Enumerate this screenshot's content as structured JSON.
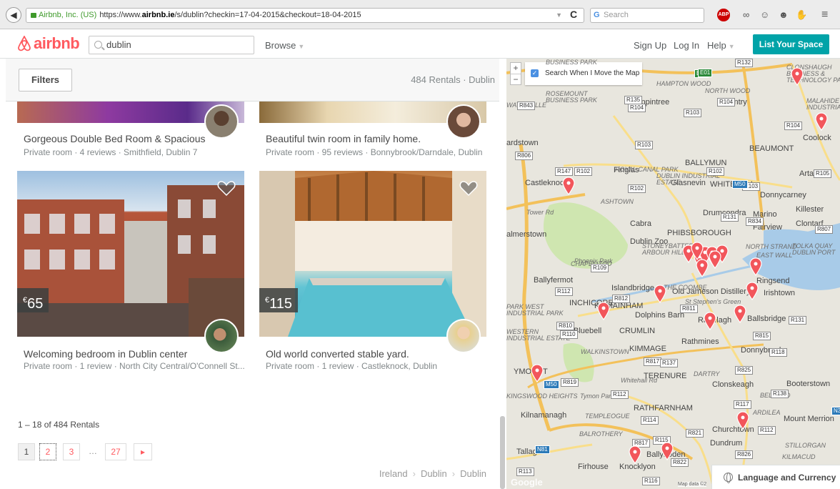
{
  "browser": {
    "site_identity": "Airbnb, Inc. (US)",
    "url_prefix": "https://www.",
    "url_domain": "airbnb.ie",
    "url_rest": "/s/dublin?checkin=17-04-2015&checkout=18-04-2015",
    "search_placeholder": "Search",
    "abp_label": "ABP"
  },
  "header": {
    "logo_text": "airbnb",
    "search_value": "dublin",
    "browse_label": "Browse",
    "signup_label": "Sign Up",
    "login_label": "Log In",
    "help_label": "Help",
    "list_space_label": "List Your Space",
    "brand_color": "#ff5a5f",
    "accent_color": "#00a3a8"
  },
  "filters": {
    "filters_label": "Filters",
    "rentals_count": "484 Rentals · Dublin"
  },
  "listings": [
    {
      "title": "Gorgeous Double Bed Room & Spacious",
      "subtitle": "Private room · 4 reviews · Smithfield, Dublin 7"
    },
    {
      "title": "Beautiful twin room in family home.",
      "subtitle": "Private room · 95 reviews · Bonnybrook/Darndale, Dublin"
    },
    {
      "title": "Welcoming bedroom in Dublin center",
      "subtitle": "Private room · 1 review · North City Central/O'Connell St...",
      "price_symbol": "€",
      "price": "65"
    },
    {
      "title": "Old world converted stable yard.",
      "subtitle": "Private room · 1 review · Castleknock, Dublin",
      "price_symbol": "€",
      "price": "115"
    }
  ],
  "pagination": {
    "range_text": "1 – 18 of 484 Rentals",
    "pages": [
      "1",
      "2",
      "3",
      "…",
      "27"
    ],
    "next_label": "▸"
  },
  "breadcrumbs": [
    "Ireland",
    "Dublin",
    "Dublin"
  ],
  "map": {
    "zoom_in": "+",
    "zoom_out": "−",
    "search_when_move": "Search When I Move the Map",
    "language_currency": "Language and Currency",
    "map_data": "Map data ©2",
    "google": "Google",
    "labels": [
      "Finglas",
      "BALLYMUN",
      "Poppintree",
      "Santry",
      "Coolock",
      "Artane",
      "BEAUMONT",
      "WHITEHALL",
      "Glasnevin",
      "Donnycarney",
      "Killester",
      "Clontarf",
      "Marino",
      "Fairview",
      "Drumcondra",
      "Cabra",
      "Dublin Zoo",
      "PHIBSBOROUGH",
      "NORTH STRAND",
      "EAST WALL",
      "Phoenix Park",
      "Islandbridge",
      "Old Jameson Distillery",
      "Ringsend",
      "Irishtown",
      "KILMAINHAM",
      "Dolphins Barn",
      "St Stephen's Green",
      "Ballsbridge",
      "Ranelagh",
      "Bluebell",
      "CRUMLIN",
      "Rathmines",
      "Donnybrook",
      "KIMMAGE",
      "TERENURE",
      "Clonskeagh",
      "Booterstown",
      "Tymon Park",
      "RATHFARNHAM",
      "Churchtown",
      "Mount Merrion",
      "Dundrum",
      "Tallaght",
      "Firhouse",
      "Knocklyon",
      "Ballyboden",
      "Castleknock",
      "Ballyfermot",
      "INCHICORE",
      "Kilnamanagh",
      "almerstown",
      "ardstown",
      "ASHTOWN",
      "ROYAL CANAL PARK",
      "ROSEMOUNT BUSINESS PARK",
      "HAMPTON WOOD",
      "NORTH WOOD",
      "CLONSHAUGH BUSINESS & TECHNOLOGY PARK",
      "MALAHIDE ROAD INDUSTRIAL PARK",
      "DUBLIN INDUSTRIAL ESTATE",
      "CHAPELIZOD",
      "THE COOMBE",
      "WALKINSTOWN",
      "TEMPLEOGUE",
      "BALROTHERY",
      "DARTRY",
      "BELFIELD",
      "ARDILEA",
      "STILLORGAN",
      "KILMACUD",
      "TOLKA QUAY DUBLIN PORT",
      "STONEYBATTER ARBOUR HILL",
      "PARK WEST INDUSTRIAL PARK",
      "WESTERN INDUSTRIAL ESTATE",
      "KINGSWOOD HEIGHTS",
      "YMOUNT",
      "Whitehall Rd",
      "Tower Rd",
      "WATERVILLE",
      "BUSINESS PARK"
    ],
    "roads": [
      "R132",
      "E01",
      "R135",
      "R104",
      "R843",
      "R104",
      "R103",
      "R103",
      "R147",
      "R102",
      "R102",
      "R102",
      "R103",
      "R105",
      "R131",
      "R834",
      "R807",
      "R109",
      "R112",
      "R812",
      "R811",
      "R131",
      "R810",
      "R110",
      "R815",
      "R817",
      "R137",
      "R118",
      "R825",
      "R138",
      "R819",
      "R112",
      "R117",
      "R114",
      "R821",
      "R112",
      "R817",
      "R115",
      "R826",
      "R822",
      "R113",
      "R116",
      "M50",
      "M50",
      "E01",
      "R806",
      "N81",
      "N31",
      "R104"
    ],
    "pins": 21,
    "pin_color": "#f2565b"
  }
}
